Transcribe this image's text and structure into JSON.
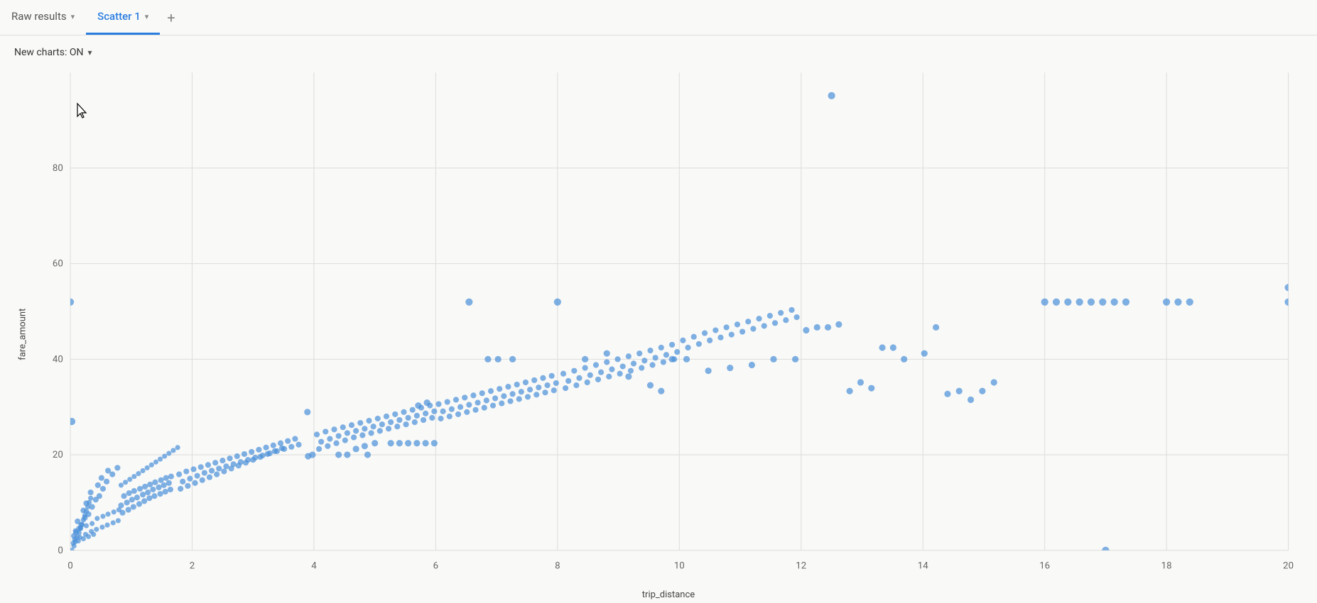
{
  "tabs": [
    {
      "id": "raw-results",
      "label": "Raw results",
      "active": false,
      "hasChevron": true
    },
    {
      "id": "scatter-1",
      "label": "Scatter 1",
      "active": true,
      "hasChevron": true
    }
  ],
  "tab_add_label": "+",
  "controls": {
    "new_charts_label": "New charts: ON",
    "chevron": "▾"
  },
  "chart": {
    "title": "Scatter 1",
    "x_axis_label": "trip_distance",
    "y_axis_label": "fare_amount",
    "y_ticks": [
      "0",
      "20",
      "40",
      "60",
      "80"
    ],
    "x_ticks": [
      "0",
      "2",
      "4",
      "6",
      "8",
      "10",
      "12",
      "14",
      "16",
      "18",
      "20"
    ]
  }
}
